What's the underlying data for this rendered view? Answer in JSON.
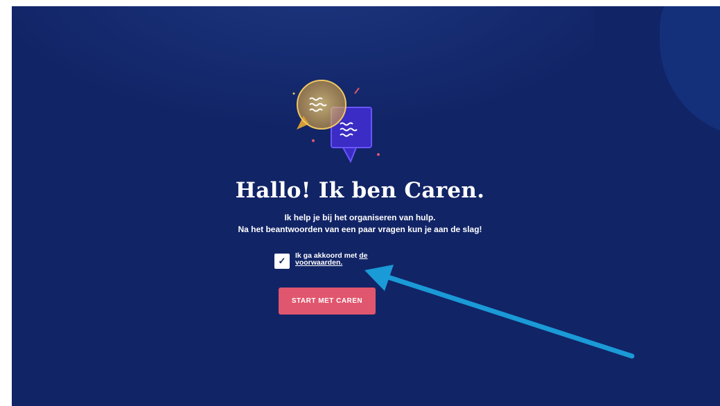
{
  "hero": {
    "title": "Hallo! Ik ben Caren.",
    "subtitle_line1": "Ik help je bij het organiseren van hulp.",
    "subtitle_line2": "Na het beantwoorden van een paar vragen kun je aan de slag!"
  },
  "agreement": {
    "checked": true,
    "check_glyph": "✓",
    "prefix": "Ik ga akkoord met ",
    "link_text": "de voorwaarden."
  },
  "start_button": {
    "label": "START MET CAREN"
  },
  "colors": {
    "background": "#112466",
    "button": "#e0566e",
    "annotation_arrow": "#1a9ad6",
    "bubble_gold": "#e8b64a",
    "bubble_purple": "#5a3df0"
  },
  "icons": {
    "illustration": "chat-bubbles-icon",
    "annotation": "annotation-arrow-icon"
  }
}
